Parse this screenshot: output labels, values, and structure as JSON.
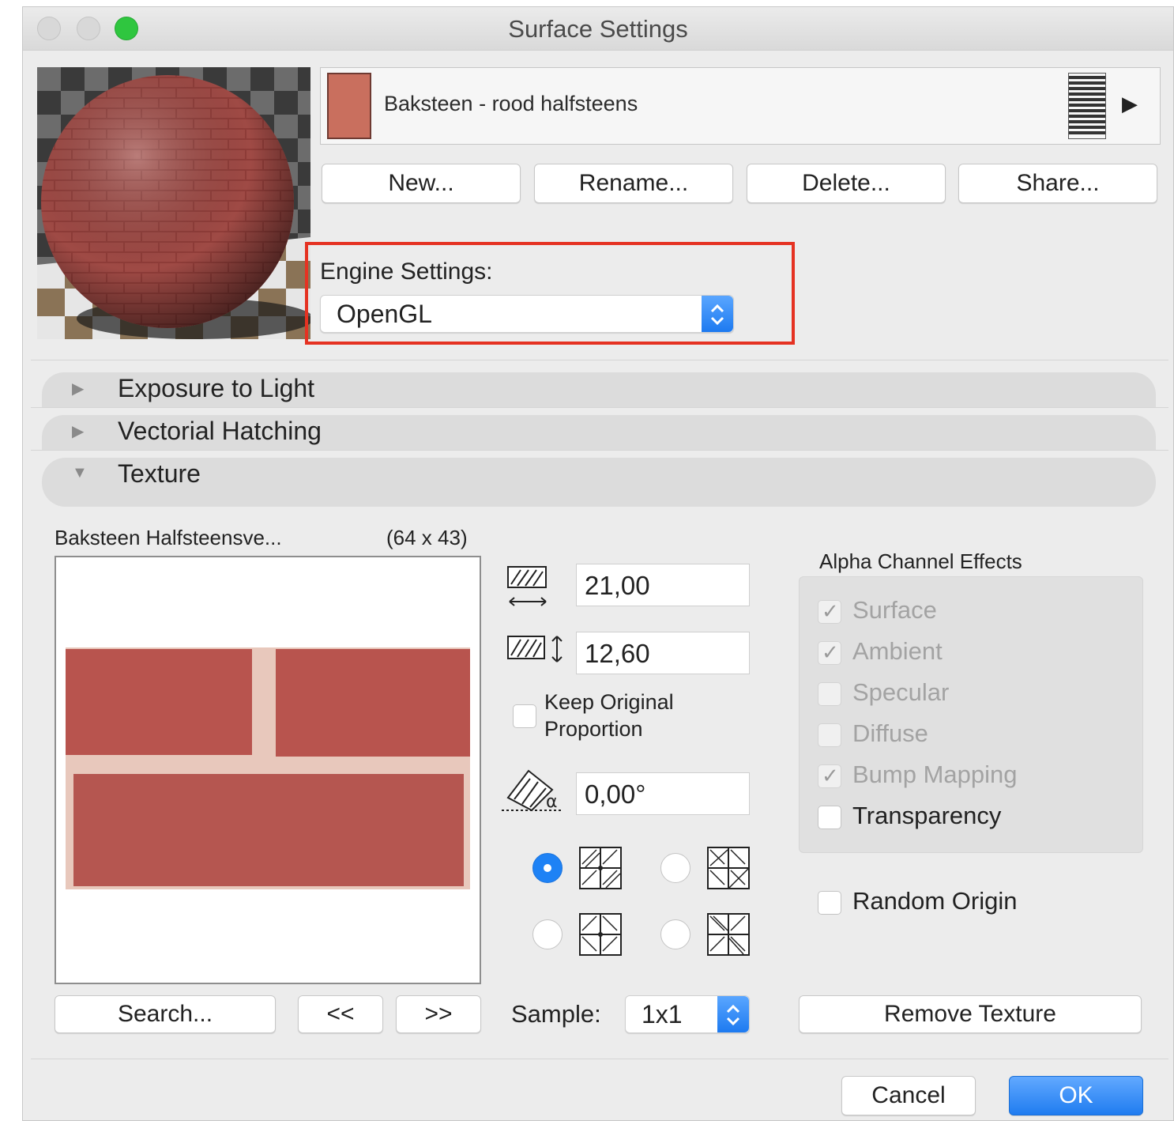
{
  "window": {
    "title": "Surface Settings"
  },
  "material": {
    "name": "Baksteen - rood halfsteens",
    "swatch_color": "#c96f5e"
  },
  "buttons": {
    "new": "New...",
    "rename": "Rename...",
    "delete": "Delete...",
    "share": "Share..."
  },
  "engine": {
    "label": "Engine Settings:",
    "value": "OpenGL"
  },
  "sections": [
    {
      "label": "Exposure to Light",
      "expanded": false
    },
    {
      "label": "Vectorial Hatching",
      "expanded": false
    },
    {
      "label": "Texture",
      "expanded": true
    }
  ],
  "texture": {
    "name": "Baksteen Halfsteensve...",
    "size": "(64 x 43)",
    "width": "21,00",
    "height": "12,60",
    "keep_proportion_line1": "Keep Original",
    "keep_proportion_line2": "Proportion",
    "keep_proportion_checked": false,
    "angle": "0,00°",
    "origin_selected": 0,
    "search": "Search...",
    "prev": "<<",
    "next": ">>",
    "sample_label": "Sample:",
    "sample_value": "1x1",
    "remove": "Remove Texture",
    "random_origin": "Random Origin",
    "random_origin_checked": false
  },
  "alpha": {
    "title": "Alpha Channel Effects",
    "items": [
      {
        "label": "Surface",
        "checked": true,
        "enabled": false
      },
      {
        "label": "Ambient",
        "checked": true,
        "enabled": false
      },
      {
        "label": "Specular",
        "checked": false,
        "enabled": false
      },
      {
        "label": "Diffuse",
        "checked": false,
        "enabled": false
      },
      {
        "label": "Bump Mapping",
        "checked": true,
        "enabled": false
      },
      {
        "label": "Transparency",
        "checked": false,
        "enabled": true
      }
    ]
  },
  "footer": {
    "cancel": "Cancel",
    "ok": "OK"
  },
  "colors": {
    "accent": "#1e82f5",
    "highlight": "#e53222"
  }
}
